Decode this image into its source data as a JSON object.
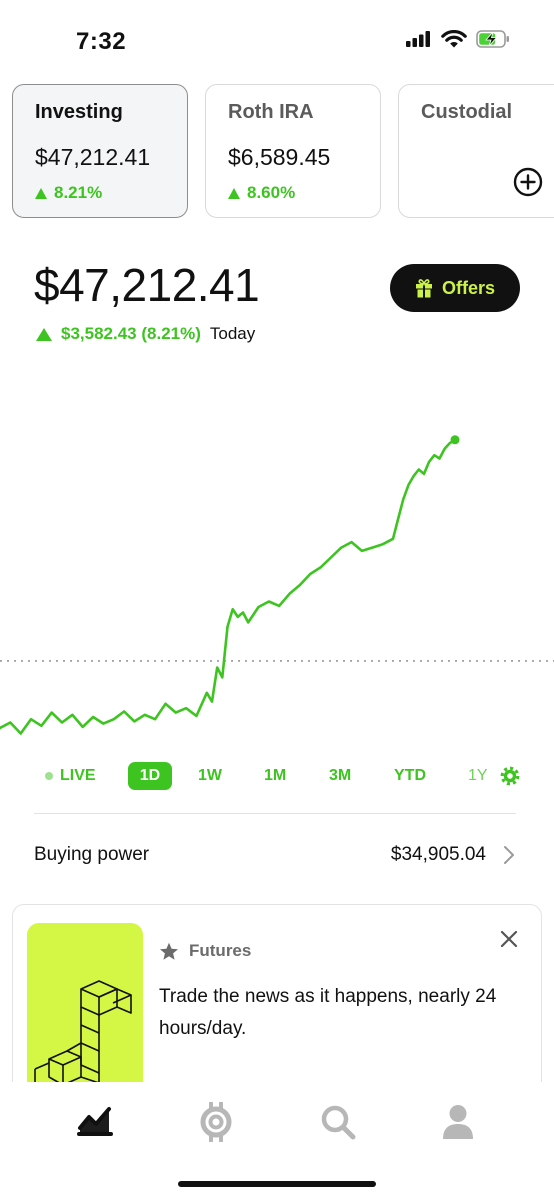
{
  "status_bar": {
    "time": "7:32",
    "icons": [
      "cellular-signal-icon",
      "wifi-icon",
      "battery-charging-icon"
    ]
  },
  "accounts": [
    {
      "name": "Investing",
      "value": "$47,212.41",
      "change": "8.21%",
      "active": true
    },
    {
      "name": "Roth IRA",
      "value": "$6,589.45",
      "change": "8.60%",
      "active": false
    },
    {
      "name": "Custodial",
      "value": "",
      "change": "",
      "active": false,
      "icon": "add-circle-icon"
    }
  ],
  "portfolio": {
    "value": "$47,212.41",
    "change_amount": "$3,582.43 (8.21%)",
    "change_period": "Today",
    "offers_label": "Offers"
  },
  "chart_data": {
    "type": "line",
    "x": [
      0,
      2,
      4,
      6,
      8,
      10,
      12,
      14,
      16,
      18,
      20,
      22,
      24,
      26,
      28,
      30,
      32,
      34,
      36,
      38,
      40,
      41,
      42,
      43,
      44,
      45,
      46,
      47,
      48,
      50,
      52,
      54,
      56,
      58,
      60,
      62,
      64,
      66,
      68,
      70,
      72,
      74,
      76,
      77,
      78,
      79,
      80,
      81,
      82,
      83,
      84,
      85,
      86,
      87,
      88
    ],
    "y": [
      28,
      28.5,
      27.5,
      28.8,
      28.2,
      29.4,
      28.5,
      29.2,
      28.1,
      29.0,
      28.4,
      28.8,
      29.5,
      28.6,
      29.2,
      28.8,
      30.2,
      29.4,
      29.8,
      29.1,
      31.2,
      30.4,
      33.5,
      32.6,
      37.2,
      38.8,
      38.1,
      38.5,
      37.6,
      39.0,
      39.5,
      39.1,
      40.2,
      41.0,
      42.0,
      42.6,
      43.5,
      44.4,
      44.9,
      44.1,
      44.4,
      44.7,
      45.2,
      47.0,
      48.8,
      50.1,
      50.9,
      51.5,
      51.1,
      52.2,
      52.8,
      52.5,
      53.4,
      53.9,
      54.2
    ],
    "baseline": 34.1,
    "xlim": [
      0,
      88
    ],
    "ylim": [
      26,
      56
    ],
    "color": "#3ec421",
    "grid": false,
    "ranges": [
      "LIVE",
      "1D",
      "1W",
      "1M",
      "3M",
      "YTD",
      "1Y"
    ],
    "selected_range": "1D"
  },
  "buying_power": {
    "label": "Buying power",
    "value": "$34,905.04"
  },
  "promo": {
    "tag": "Futures",
    "text": "Trade the news as it happens, nearly 24 hours/day."
  },
  "bottom_nav": [
    {
      "name": "nav-home",
      "icon": "portfolio-chart-icon",
      "active": true
    },
    {
      "name": "nav-crypto",
      "icon": "crypto-icon",
      "active": false
    },
    {
      "name": "nav-search",
      "icon": "search-icon",
      "active": false
    },
    {
      "name": "nav-account",
      "icon": "person-icon",
      "active": false
    }
  ],
  "colors": {
    "accent": "#3ec421",
    "offers_text": "#ccf24a",
    "promo_bg": "#d4f644",
    "dark": "#111111"
  }
}
